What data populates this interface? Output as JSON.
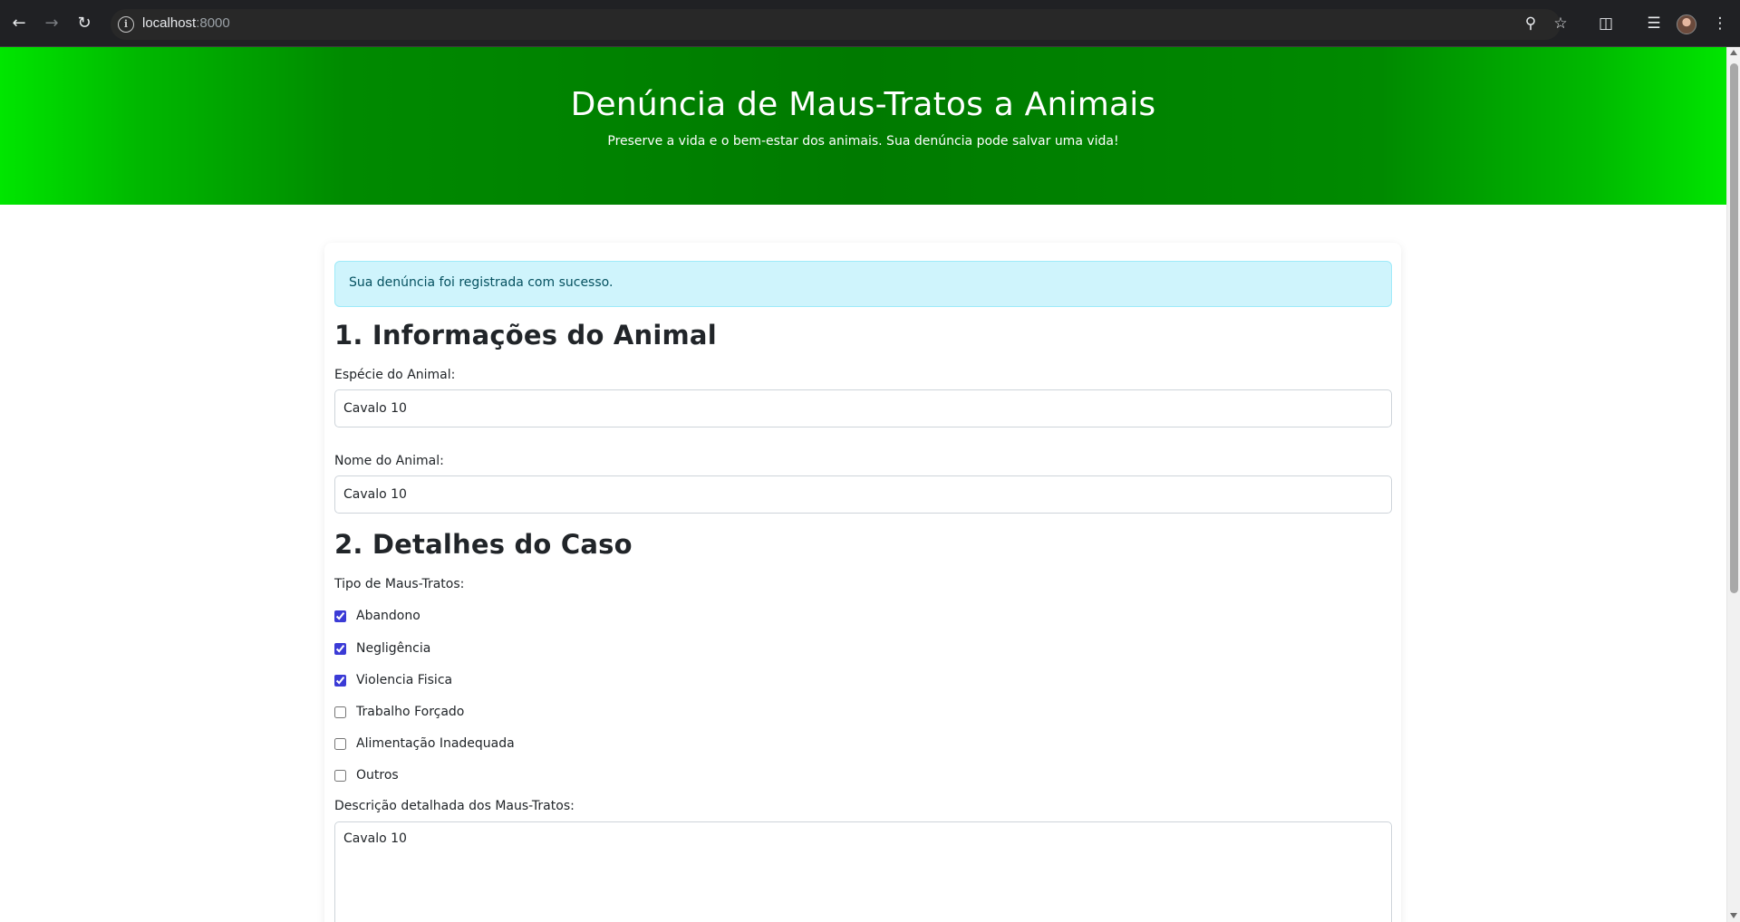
{
  "browser": {
    "url_host": "localhost",
    "url_port": ":8000"
  },
  "header": {
    "title": "Denúncia de Maus-Tratos a Animais",
    "subtitle": "Preserve a vida e o bem-estar dos animais. Sua denúncia pode salvar uma vida!"
  },
  "alert": {
    "message": "Sua denúncia foi registrada com sucesso."
  },
  "section1": {
    "title": "1. Informações do Animal",
    "species_label": "Espécie do Animal:",
    "species_value": "Cavalo 10",
    "name_label": "Nome do Animal:",
    "name_value": "Cavalo 10"
  },
  "section2": {
    "title": "2. Detalhes do Caso",
    "type_label": "Tipo de Maus-Tratos:",
    "options": [
      {
        "label": "Abandono",
        "checked": true
      },
      {
        "label": "Negligência",
        "checked": true
      },
      {
        "label": "Violencia Fisica",
        "checked": true
      },
      {
        "label": "Trabalho Forçado",
        "checked": false
      },
      {
        "label": "Alimentação Inadequada",
        "checked": false
      },
      {
        "label": "Outros",
        "checked": false
      }
    ],
    "description_label": "Descrição detalhada dos Maus-Tratos:",
    "description_value": "Cavalo 10"
  },
  "colors": {
    "header_green": "#007a00",
    "header_edge_green": "#00e600",
    "alert_bg": "#cff4fc",
    "alert_text": "#055160",
    "checkbox_accent": "#3b3bd6"
  }
}
